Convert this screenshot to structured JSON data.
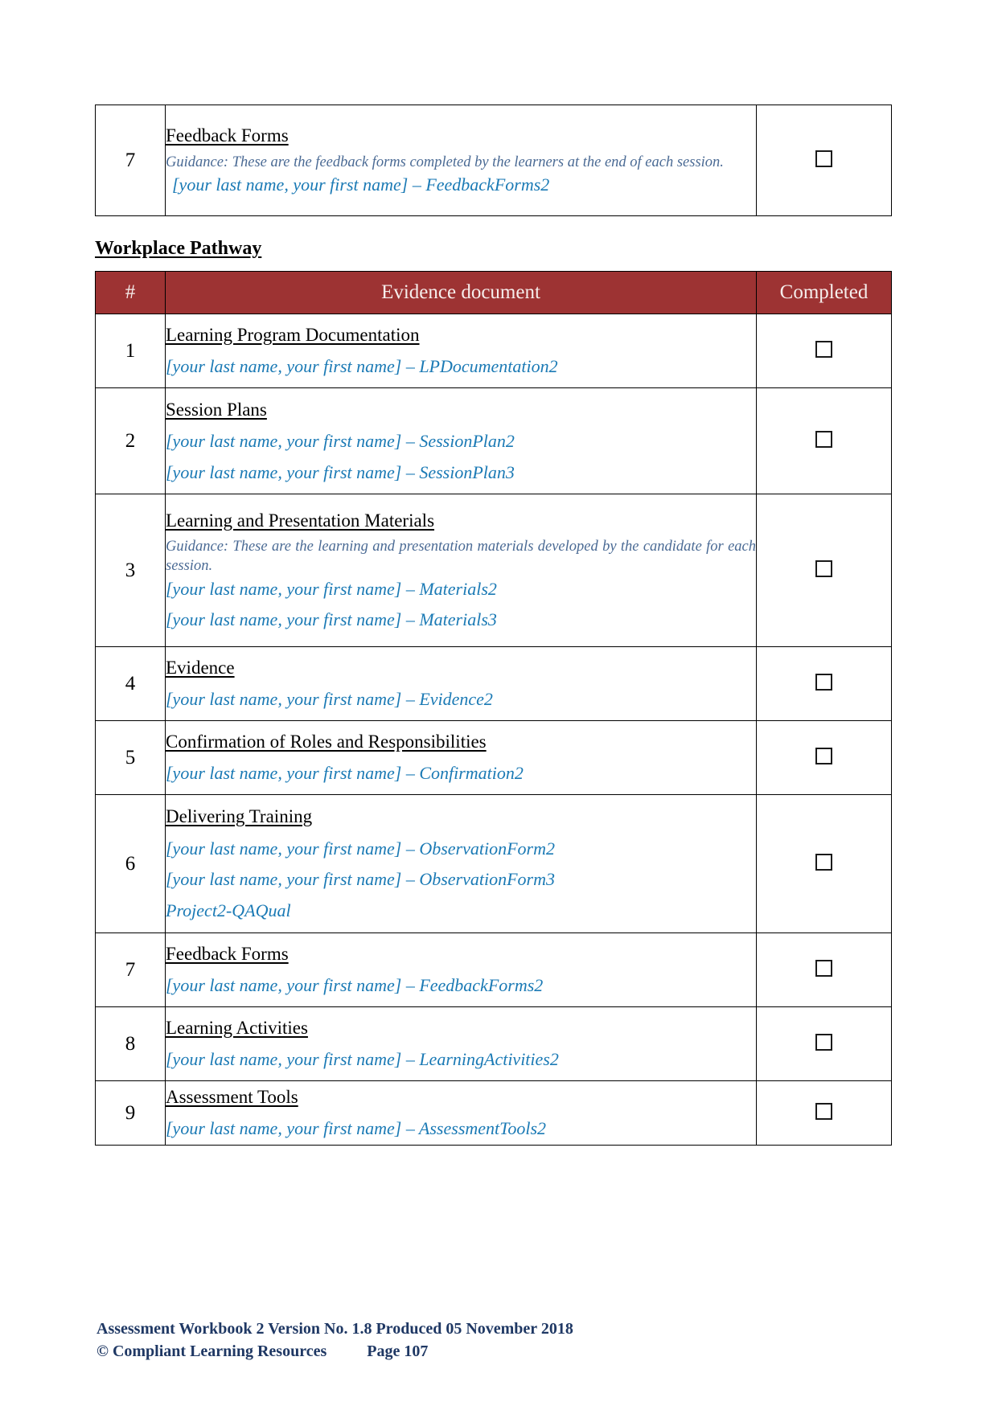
{
  "document": {
    "top_table": {
      "rows": [
        {
          "num": "7",
          "title": "Feedback Forms",
          "guidance": "Guidance: These are the feedback forms completed by the learners at the end of each session.",
          "filenames": [
            "[your last name, your first name] – FeedbackForms2"
          ],
          "completed_checkbox": "unchecked"
        }
      ]
    },
    "section_heading": "Workplace Pathway",
    "table": {
      "headers": {
        "num": "#",
        "document": "Evidence document",
        "completed": "Completed"
      },
      "rows": [
        {
          "num": "1",
          "title": "Learning Program Documentation",
          "guidance": "",
          "filenames": [
            "[your last name, your first name] – LPDocumentation2"
          ],
          "completed_checkbox": "unchecked"
        },
        {
          "num": "2",
          "title": "Session Plans",
          "guidance": "",
          "filenames": [
            "[your last name, your first name] – SessionPlan2",
            "[your last name, your first name] – SessionPlan3"
          ],
          "completed_checkbox": "unchecked"
        },
        {
          "num": "3",
          "title": "Learning and Presentation Materials ",
          "guidance": "Guidance: These are the learning and presentation materials developed by the candidate for each session.",
          "filenames": [
            "[your last name, your first name] – Materials2",
            "[your last name, your first name] – Materials3"
          ],
          "completed_checkbox": "unchecked"
        },
        {
          "num": "4",
          "title": "Evidence",
          "guidance": "",
          "filenames": [
            "[your last name, your first name] – Evidence2"
          ],
          "completed_checkbox": "unchecked"
        },
        {
          "num": "5",
          "title": "Confirmation of Roles and Responsibilities",
          "guidance": "",
          "filenames": [
            "[your last name, your first name] – Confirmation2"
          ],
          "completed_checkbox": "unchecked"
        },
        {
          "num": "6",
          "title": "Delivering Training",
          "guidance": "",
          "filenames": [
            "[your last name, your first name] – ObservationForm2",
            "[your last name, your first name] – ObservationForm3",
            "Project2-QAQual"
          ],
          "completed_checkbox": "unchecked"
        },
        {
          "num": "7",
          "title": "Feedback Forms",
          "guidance": "",
          "filenames": [
            "[your last name, your first name] – FeedbackForms2"
          ],
          "completed_checkbox": "unchecked"
        },
        {
          "num": "8",
          "title": "Learning Activities",
          "guidance": "",
          "filenames": [
            "[your last name, your first name] – LearningActivities2"
          ],
          "completed_checkbox": "unchecked"
        },
        {
          "num": "9",
          "title": "Assessment Tools",
          "guidance": "",
          "filenames": [
            "[your last name, your first name] – AssessmentTools2"
          ],
          "completed_checkbox": "unchecked"
        }
      ]
    },
    "footer": {
      "line1": "Assessment Workbook 2 Version No. 1.8 Produced 05 November 2018",
      "line2": "© Compliant Learning Resources          Page 107"
    }
  },
  "colors": {
    "header_maroon": "#9d3333",
    "header_text": "#f6eeec",
    "filename_blue": "#1b7ab5",
    "guidance_blue": "#4a6a94",
    "footer_navy": "#1f3864",
    "border": "#000000"
  }
}
